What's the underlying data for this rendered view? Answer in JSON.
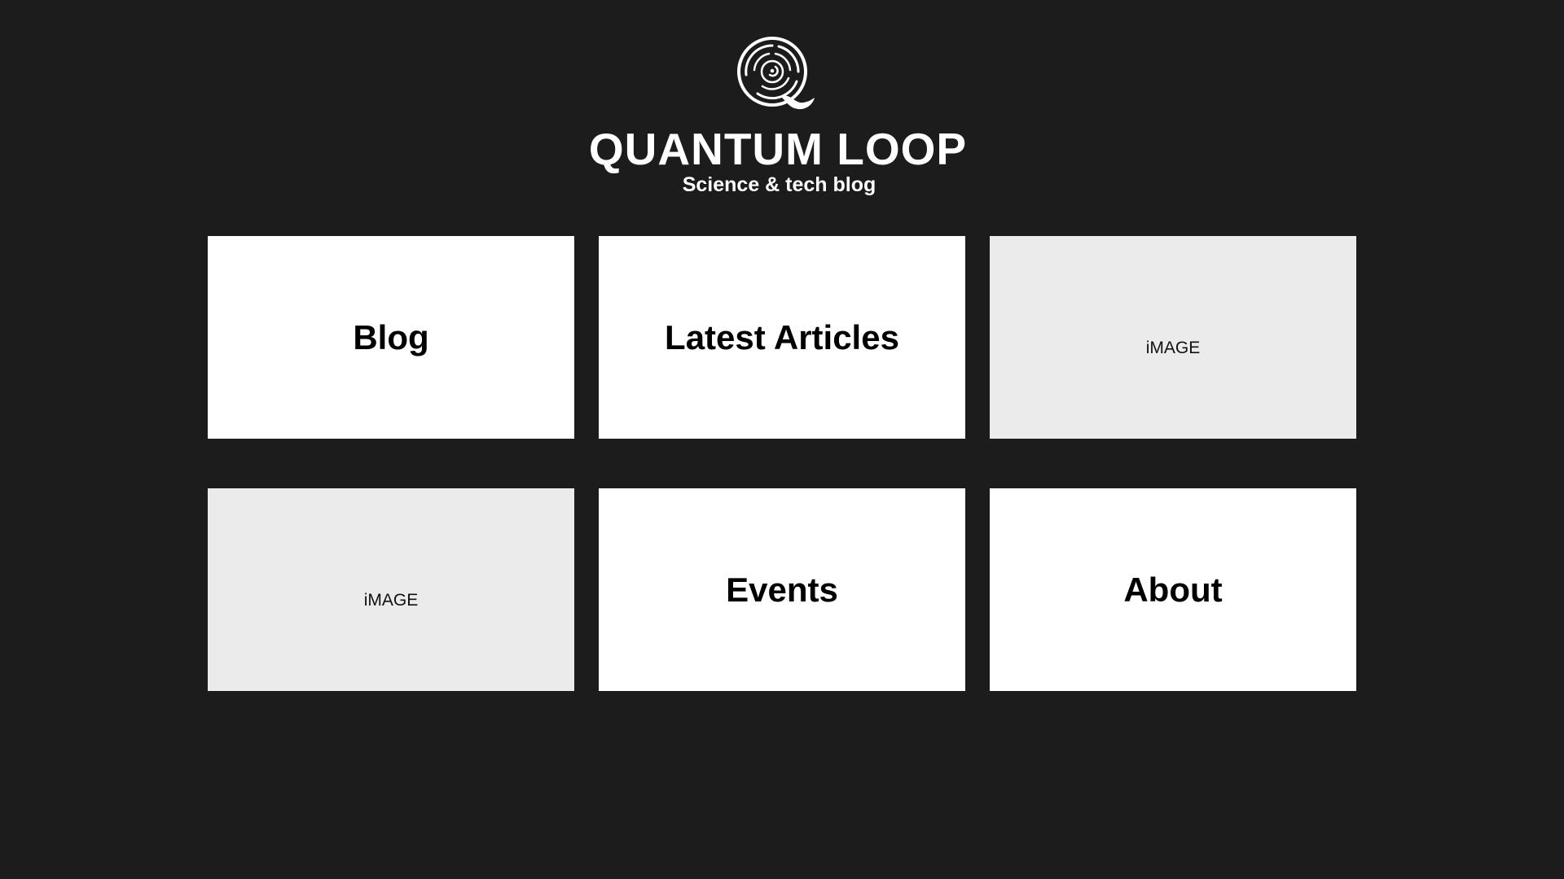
{
  "brand": {
    "logo_icon": "quantum-loop-q-logo",
    "title": "QUANTUM LOOP",
    "subtitle": "Science & tech blog"
  },
  "colors": {
    "background": "#1c1c1c",
    "card": "#ffffff",
    "image_placeholder": "#ebebeb",
    "text_light": "#ffffff",
    "text_dark": "#000000"
  },
  "grid": {
    "tiles": [
      {
        "type": "link",
        "label": "Blog"
      },
      {
        "type": "link",
        "label": "Latest Articles"
      },
      {
        "type": "image",
        "label": "iMAGE"
      },
      {
        "type": "image",
        "label": "iMAGE"
      },
      {
        "type": "link",
        "label": "Events"
      },
      {
        "type": "link",
        "label": "About"
      }
    ]
  }
}
